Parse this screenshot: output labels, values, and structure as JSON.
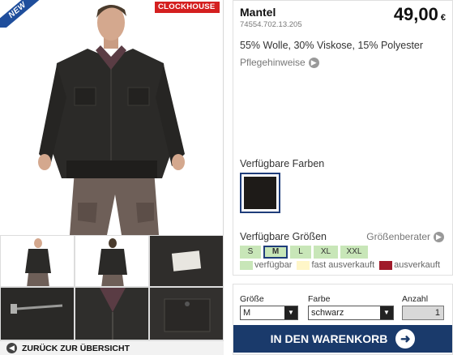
{
  "badges": {
    "new": "NEW",
    "brand": "CLOCKHOUSE"
  },
  "product": {
    "title": "Mantel",
    "sku": "74554.702.13.205",
    "price": "49,00",
    "currency": "€",
    "material": "55% Wolle, 30% Viskose, 15% Polyester",
    "care_link": "Pflegehinweise"
  },
  "colors": {
    "label": "Verfügbare Farben",
    "swatches": [
      {
        "name": "schwarz",
        "hex": "#1e1b18",
        "selected": true
      }
    ]
  },
  "sizes": {
    "label": "Verfügbare Größen",
    "advisor_link": "Größenberater",
    "options": [
      "S",
      "M",
      "L",
      "XL",
      "XXL"
    ],
    "selected": "M",
    "legend": [
      {
        "label": "verfügbar",
        "color": "#c8e6b8"
      },
      {
        "label": "fast ausverkauft",
        "color": "#fff6c8"
      },
      {
        "label": "ausverkauft",
        "color": "#a01a2a"
      }
    ]
  },
  "order": {
    "size_label": "Größe",
    "size_value": "M",
    "color_label": "Farbe",
    "color_value": "schwarz",
    "qty_label": "Anzahl",
    "qty_value": "1",
    "add_to_cart": "IN DEN WARENKORB"
  },
  "navigation": {
    "back": "ZURÜCK ZUR ÜBERSICHT"
  },
  "colors_theme": {
    "accent": "#1a3a6b",
    "brand_red": "#d41f1f",
    "new_blue": "#1f4e9c"
  }
}
